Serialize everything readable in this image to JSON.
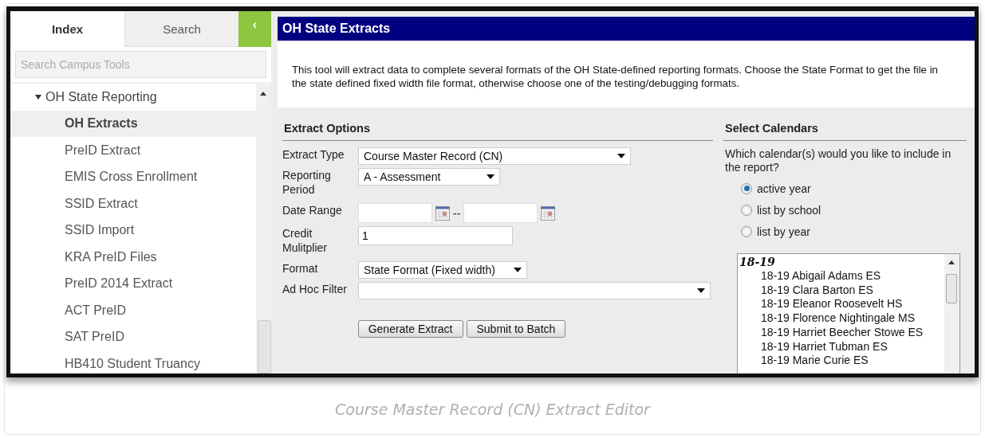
{
  "sidebar": {
    "tabs": [
      {
        "label": "Index",
        "selected": true
      },
      {
        "label": "Search",
        "selected": false
      }
    ],
    "collapse_button": "‹",
    "search": {
      "placeholder": "Search Campus Tools"
    },
    "tree": [
      {
        "label": "OH State Reporting",
        "expanded": true,
        "children": [
          {
            "label": "OH Extracts",
            "selected": true
          },
          {
            "label": "PreID Extract",
            "selected": false
          },
          {
            "label": "EMIS Cross Enrollment",
            "selected": false
          },
          {
            "label": "SSID Extract",
            "selected": false
          },
          {
            "label": "SSID Import",
            "selected": false
          },
          {
            "label": "KRA PreID Files",
            "selected": false
          },
          {
            "label": "PreID 2014 Extract",
            "selected": false
          },
          {
            "label": "ACT PreID",
            "selected": false
          },
          {
            "label": "SAT PreID",
            "selected": false
          },
          {
            "label": "HB410 Student Truancy",
            "selected": false
          }
        ]
      }
    ]
  },
  "header": {
    "title": "OH State Extracts"
  },
  "description": "This tool will extract data to complete several formats of the OH State-defined reporting formats. Choose the State Format to get the file in the state defined fixed width file format, otherwise choose one of the testing/debugging formats.",
  "extract_options": {
    "title": "Extract Options",
    "fields": [
      {
        "kind": "select",
        "label": "Extract Type",
        "value": "Course Master Record (CN)"
      },
      {
        "kind": "select",
        "label": "Reporting Period",
        "value": "A - Assessment"
      },
      {
        "kind": "daterange",
        "label": "Date Range",
        "separator": "--"
      },
      {
        "kind": "text",
        "label": "Credit Mulitplier",
        "value": "1"
      },
      {
        "kind": "select",
        "label": "Format",
        "value": "State Format (Fixed width)"
      },
      {
        "kind": "select",
        "label": "Ad Hoc Filter"
      }
    ],
    "buttons": [
      "Generate Extract",
      "Submit to Batch"
    ]
  },
  "select_calendars": {
    "title": "Select Calendars",
    "question": "Which calendar(s) would you like to include in the report?",
    "options": [
      {
        "label": "active year",
        "selected": true
      },
      {
        "label": "list by school",
        "selected": false
      },
      {
        "label": "list by year",
        "selected": false
      }
    ],
    "calendars": [
      {
        "label": "18-19",
        "children": [
          {
            "label": "18-19 Abigail Adams ES"
          },
          {
            "label": "18-19 Clara Barton ES"
          },
          {
            "label": "18-19 Eleanor Roosevelt HS"
          },
          {
            "label": "18-19 Florence Nightingale MS"
          },
          {
            "label": "18-19 Harriet Beecher Stowe ES"
          },
          {
            "label": "18-19 Harriet Tubman ES"
          },
          {
            "label": "18-19 Marie Curie ES"
          }
        ]
      }
    ]
  },
  "caption": "Course Master Record (CN) Extract Editor"
}
